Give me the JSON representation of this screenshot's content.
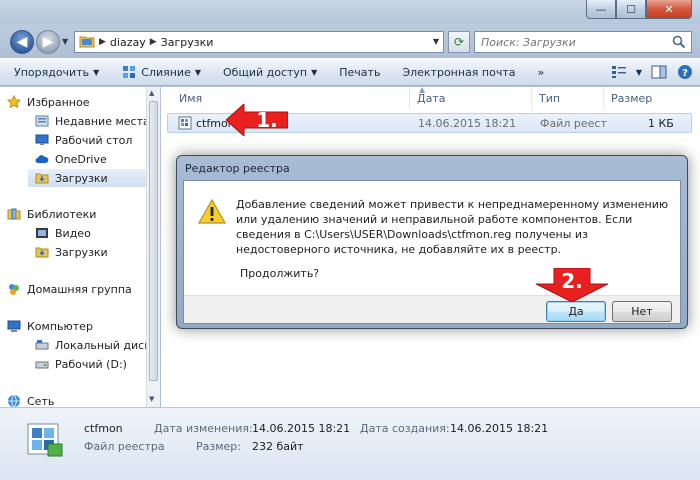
{
  "window": {
    "controls": {
      "minimize": "—",
      "maximize": "☐",
      "close": "✕"
    }
  },
  "address": {
    "segments": [
      "diazay",
      "Загрузки"
    ],
    "search_placeholder": "Поиск: Загрузки"
  },
  "toolbar": {
    "items": [
      "Упорядочить",
      "Слияние",
      "Общий доступ",
      "Печать",
      "Электронная почта",
      "»"
    ]
  },
  "navigation": {
    "favorites_header": "Избранное",
    "favorites": [
      "Недавние места",
      "Рабочий стол",
      "OneDrive",
      "Загрузки"
    ],
    "libraries_header": "Библиотеки",
    "libraries": [
      "Видео",
      "Загрузки"
    ],
    "homegroup": "Домашняя группа",
    "computer_header": "Компьютер",
    "drives": [
      "Локальный диск (C",
      "Рабочий (D:)"
    ],
    "network": "Сеть"
  },
  "file_list": {
    "columns": [
      "Имя",
      "Дата",
      "Тип",
      "Размер"
    ],
    "rows": [
      {
        "name": "ctfmon",
        "date": "14.06.2015 18:21",
        "type": "Файл реест",
        "size": "1 КБ"
      }
    ]
  },
  "details": {
    "name": "ctfmon",
    "type": "Файл реестра",
    "modified_label": "Дата изменения:",
    "modified_value": "14.06.2015 18:21",
    "size_label": "Размер:",
    "size_value": "232 байт",
    "created_label": "Дата создания:",
    "created_value": "14.06.2015 18:21"
  },
  "dialog": {
    "title": "Редактор реестра",
    "message": "Добавление сведений может привести к непреднамеренному изменению или удалению значений и неправильной работе компонентов. Если сведения в C:\\Users\\USER\\Downloads\\ctfmon.reg получены из недостоверного источника, не добавляйте их в реестр.",
    "question": "Продолжить?",
    "yes_label": "Да",
    "no_label": "Нет"
  },
  "annotations": {
    "step1": "1.",
    "step2": "2.",
    "color": "#e8201f"
  }
}
